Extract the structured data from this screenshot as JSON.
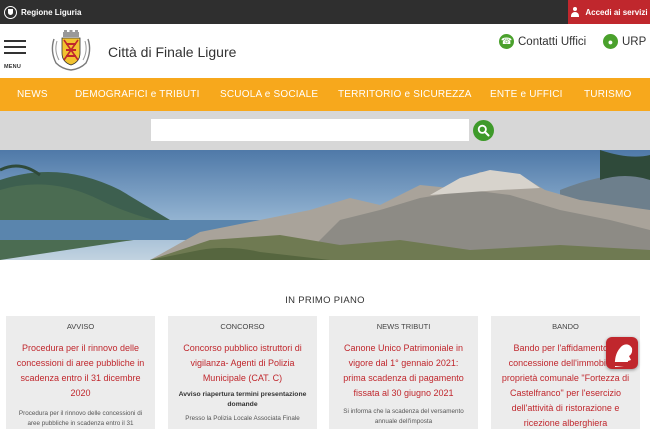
{
  "topbar": {
    "brand_label": "Regione Liguria",
    "login_label": "Accedi ai servizi"
  },
  "header": {
    "menu_label": "MENU",
    "site_title": "Città di Finale Ligure",
    "contatti_label": "Contatti Uffici",
    "urp_label": "URP"
  },
  "nav": {
    "items": [
      "NEWS",
      "DEMOGRAFICI e TRIBUTI",
      "SCUOLA e SOCIALE",
      "TERRITORIO e SICUREZZA",
      "ENTE e UFFICI",
      "TURISMO"
    ]
  },
  "search": {
    "value": "",
    "placeholder": ""
  },
  "section": {
    "title": "IN PRIMO PIANO"
  },
  "cards": [
    {
      "category": "AVVISO",
      "title": "Procedura per il rinnovo delle concessioni di aree pubbliche in scadenza entro il 31 dicembre 2020",
      "subtitle": "",
      "body": "Procedura per il rinnovo delle concessioni di aree pubbliche in scadenza entro il 31"
    },
    {
      "category": "CONCORSO",
      "title": "Concorso pubblico istruttori di vigilanza- Agenti di Polizia Municipale (CAT. C)",
      "subtitle": "Avviso riapertura termini presentazione domande",
      "body": "Presso la Polizia Locale Associata Finale"
    },
    {
      "category": "NEWS TRIBUTI",
      "title": "Canone Unico Patrimoniale in vigore dal 1° gennaio 2021: prima scadenza di pagamento fissata al 30 giugno 2021",
      "subtitle": "",
      "body": "Si informa che la scadenza del versamento annuale dell'imposta"
    },
    {
      "category": "BANDO",
      "title": "Bando per l'affidamento in concessione dell'immobile di proprietà comunale \"Fortezza di Castelfranco\" per l'esercizio dell'attività di ristorazione e ricezione alberghiera",
      "subtitle": "",
      "body": ""
    }
  ],
  "colors": {
    "nav_bg": "#f7a81c",
    "accent_red": "#c0272d",
    "green": "#4aa12c",
    "topbar_bg": "#2f2f2f"
  }
}
